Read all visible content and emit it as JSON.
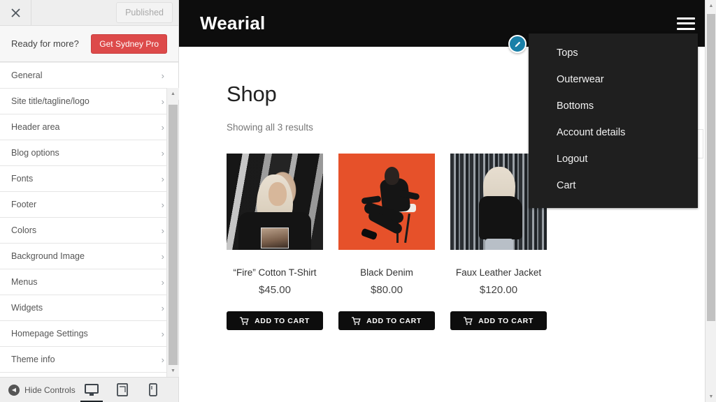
{
  "customizer": {
    "close_label": "×",
    "published_label": "Published",
    "pro": {
      "prompt": "Ready for more?",
      "button_label": "Get Sydney Pro"
    },
    "sections": [
      {
        "label": "General"
      },
      {
        "label": "Site title/tagline/logo"
      },
      {
        "label": "Header area"
      },
      {
        "label": "Blog options"
      },
      {
        "label": "Fonts"
      },
      {
        "label": "Footer"
      },
      {
        "label": "Colors"
      },
      {
        "label": "Background Image"
      },
      {
        "label": "Menus"
      },
      {
        "label": "Widgets"
      },
      {
        "label": "Homepage Settings"
      },
      {
        "label": "Theme info"
      }
    ],
    "chevron": "›",
    "footer": {
      "hide_controls_label": "Hide Controls",
      "devices": [
        {
          "name": "desktop",
          "active": true
        },
        {
          "name": "tablet",
          "active": false
        },
        {
          "name": "mobile",
          "active": false
        }
      ]
    }
  },
  "preview": {
    "site": {
      "logo": "Wearial",
      "menu_items": [
        {
          "label": "Tops"
        },
        {
          "label": "Outerwear"
        },
        {
          "label": "Bottoms"
        },
        {
          "label": "Account details"
        },
        {
          "label": "Logout"
        },
        {
          "label": "Cart"
        }
      ]
    },
    "shop": {
      "title": "Shop",
      "results_text": "Showing all 3 results",
      "products": [
        {
          "name": "“Fire” Cotton T-Shirt",
          "price": "$45.00",
          "button_label": "ADD TO CART",
          "image_alt": "woman-graffiti-wall-black-tshirt"
        },
        {
          "name": "Black Denim",
          "price": "$80.00",
          "button_label": "ADD TO CART",
          "image_alt": "person-black-outfit-orange-background"
        },
        {
          "name": "Faux Leather Jacket",
          "price": "$120.00",
          "button_label": "ADD TO CART",
          "image_alt": "blonde-woman-leather-jacket-striped-wall"
        }
      ]
    }
  },
  "colors": {
    "pro_button": "#dd4a4a",
    "header_black": "#0d0d0d",
    "menu_black": "#1f1f1f",
    "edit_pin_blue": "#1a80a8",
    "product2_background": "#e6512a"
  }
}
